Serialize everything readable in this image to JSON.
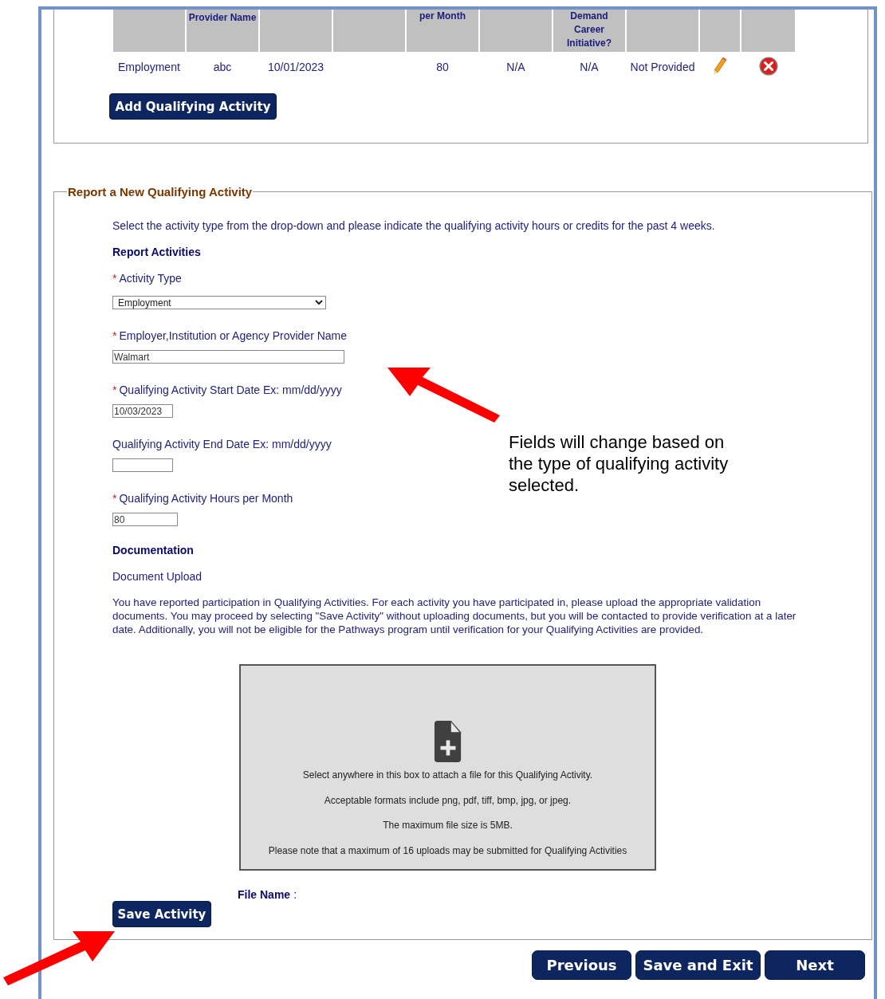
{
  "activities_table": {
    "columns": [
      {},
      {
        "label": "Provider Name"
      },
      {},
      {},
      {
        "label": "per Month"
      },
      {},
      {
        "label": "Demand Career Initiative?"
      },
      {},
      {},
      {}
    ],
    "rows": [
      {
        "cells": [
          "Employment",
          "abc",
          "10/01/2023",
          null,
          "80",
          "N/A",
          "N/A",
          "Not Provided"
        ],
        "editable": true,
        "deletable": true
      }
    ]
  },
  "add_button": "Add Qualifying Activity",
  "report_section": {
    "legend": "Report a New Qualifying Activity",
    "intro": "Select the activity type from the drop-down and please indicate the qualifying activity hours or credits for the past 4 weeks.",
    "heading": "Report Activities",
    "fields": [
      {
        "kind": "select",
        "required_mark": "*",
        "label": "Activity Type",
        "value": "Employment"
      },
      {
        "kind": "text",
        "required_mark": "*",
        "label": "Employer,Institution or Agency Provider Name",
        "value": "Walmart"
      },
      {
        "kind": "text",
        "required_mark": "*",
        "label": "Qualifying Activity Start Date Ex: mm/dd/yyyy",
        "value": "10/03/2023"
      },
      {
        "kind": "text",
        "label": "Qualifying Activity End Date Ex: mm/dd/yyyy"
      },
      {
        "kind": "text",
        "required_mark": "*",
        "label": "Qualifying Activity Hours per Month",
        "value": "80"
      }
    ],
    "doc_heading": "Documentation",
    "doc_subheading": "Document Upload",
    "doc_note": "You have reported participation in Qualifying Activities. For each activity you have participated in, please upload the appropriate validation documents. You may proceed by selecting \"Save Activity\" without uploading documents, but you will be contacted to provide verification at a later date. Additionally, you will not be eligible for the Pathways program until verification for your Qualifying Activities are provided.",
    "upload_box": [
      "Select anywhere in this box to attach a file for this Qualifying Activity.",
      "Acceptable formats include png, pdf, tiff, bmp, jpg, or jpeg.",
      "The maximum file size is 5MB.",
      "Please note that a maximum of 16 uploads may be submitted for Qualifying Activities"
    ],
    "file_name_label": "File Name",
    "file_name_sep": ":",
    "save_button": "Save Activity"
  },
  "nav_buttons": [
    "Previous",
    "Save and Exit",
    "Next"
  ],
  "annotation": "Fields will change based on the type of qualifying activity selected."
}
